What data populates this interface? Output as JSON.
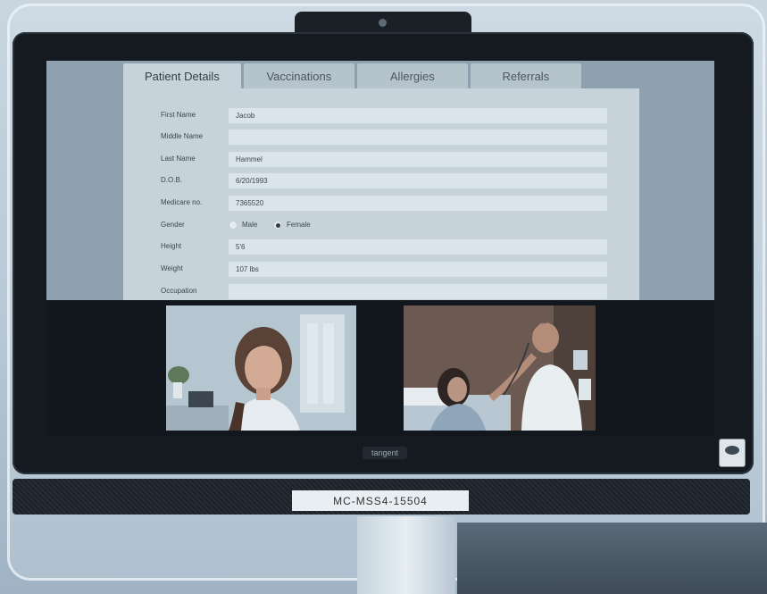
{
  "tabs": [
    {
      "label": "Patient Details",
      "active": true
    },
    {
      "label": "Vaccinations",
      "active": false
    },
    {
      "label": "Allergies",
      "active": false
    },
    {
      "label": "Referrals",
      "active": false
    }
  ],
  "form": {
    "first_name": {
      "label": "First Name",
      "value": "Jacob"
    },
    "middle_name": {
      "label": "Middle Name",
      "value": ""
    },
    "last_name": {
      "label": "Last Name",
      "value": "Hammel"
    },
    "dob": {
      "label": "D.O.B.",
      "value": "6/20/1993"
    },
    "medicare": {
      "label": "Medicare no.",
      "value": "7365520"
    },
    "gender": {
      "label": "Gender",
      "options": [
        "Male",
        "Female"
      ],
      "selected": "Female"
    },
    "height": {
      "label": "Height",
      "value": "5'6"
    },
    "weight": {
      "label": "Weight",
      "value": "107 lbs"
    },
    "occupation": {
      "label": "Occupation",
      "value": ""
    }
  },
  "device": {
    "brand": "tangent",
    "asset_tag": "MC-MSS4-15504"
  }
}
